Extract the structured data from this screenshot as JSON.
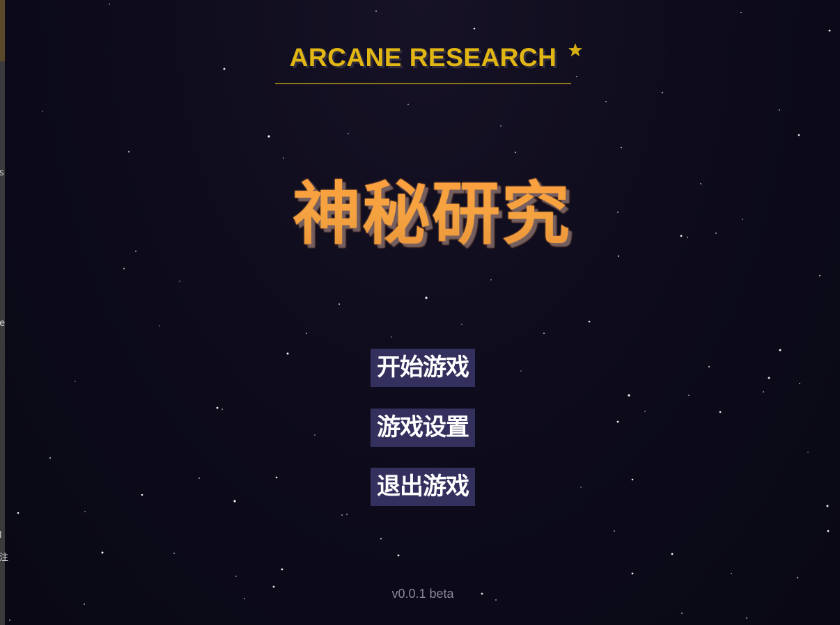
{
  "game": {
    "subtitle": "ARCANE RESEARCH",
    "title": "神秘研究",
    "version": "v0.0.1 beta"
  },
  "menu": {
    "start_label": "开始游戏",
    "settings_label": "游戏设置",
    "exit_label": "退出游戏"
  },
  "left_strip": {
    "fragments": [
      "s",
      "e",
      "l",
      "注"
    ]
  },
  "colors": {
    "background": "#0b0a17",
    "subtitle": "#e2b714",
    "title": "#f5a340",
    "button_bg": "#34305e",
    "button_text": "#ffffff",
    "version": "#8a8896"
  },
  "icons": {
    "title_decoration": "star-icon"
  }
}
